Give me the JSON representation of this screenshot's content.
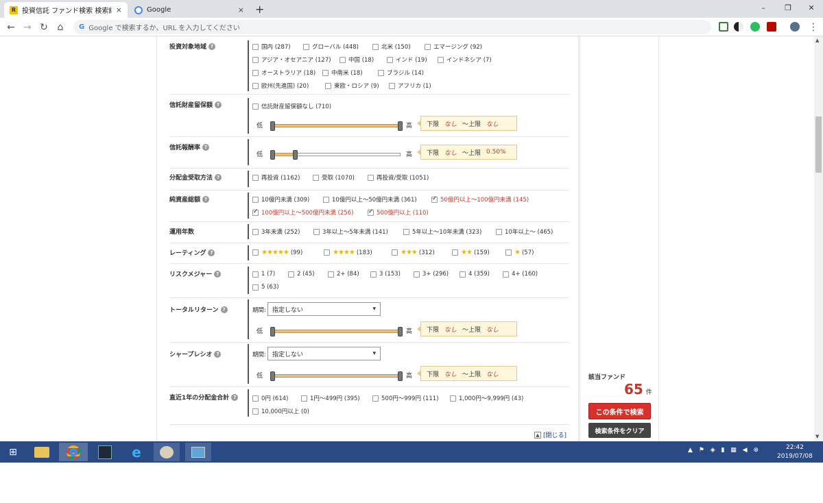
{
  "browser": {
    "tabs": [
      {
        "title": "投資信託 ファンド検索 検索結果",
        "close": "×"
      },
      {
        "title": "Google",
        "close": "×"
      }
    ],
    "new_tab": "+",
    "omnibox_placeholder": "Google で検索するか、URL を入力してください",
    "window_controls": {
      "minimize": "–",
      "maximize": "❐",
      "close": "✕"
    }
  },
  "filters": {
    "region": {
      "label": "投資対象地域",
      "options": [
        {
          "text": "国内 (287)",
          "checked": false
        },
        {
          "text": "グローバル (448)",
          "checked": false
        },
        {
          "text": "北米 (150)",
          "checked": false
        },
        {
          "text": "エマージング (92)",
          "checked": false
        },
        {
          "text": "アジア・オセアニア (127)",
          "checked": false
        },
        {
          "text": "中国 (18)",
          "checked": false
        },
        {
          "text": "インド (19)",
          "checked": false
        },
        {
          "text": "インドネシア (7)",
          "checked": false
        },
        {
          "text": "オーストラリア (18)",
          "checked": false
        },
        {
          "text": "中南米 (18)",
          "checked": false
        },
        {
          "text": "ブラジル (14)",
          "checked": false
        },
        {
          "text": "欧州(先進国) (20)",
          "checked": false
        },
        {
          "text": "東欧・ロシア (9)",
          "checked": false
        },
        {
          "text": "アフリカ (1)",
          "checked": false
        }
      ]
    },
    "reserve": {
      "label": "信託財産留保額",
      "options": [
        {
          "text": "信託財産留保額なし (710)",
          "checked": false
        }
      ],
      "low": "低",
      "high": "高",
      "range": {
        "min_label": "下限",
        "min_value": "なし",
        "max_label": "～上限",
        "max_value": "なし"
      }
    },
    "fee": {
      "label": "信託報酬率",
      "low": "低",
      "high": "高",
      "slider_fraction": 0.18,
      "range": {
        "min_label": "下限",
        "min_value": "なし",
        "max_label": "～上限",
        "max_value": "0.50%"
      }
    },
    "distribution": {
      "label": "分配金受取方法",
      "options": [
        {
          "text": "再投資 (1162)",
          "checked": false
        },
        {
          "text": "受取 (1070)",
          "checked": false
        },
        {
          "text": "再投資/受取 (1051)",
          "checked": false
        }
      ]
    },
    "assets": {
      "label": "純資産総額",
      "options": [
        {
          "text": "10億円未満 (309)",
          "checked": false
        },
        {
          "text": "10億円以上～50億円未満 (361)",
          "checked": false
        },
        {
          "text": "50億円以上～100億円未満 (145)",
          "checked": true
        },
        {
          "text": "100億円以上～500億円未満 (256)",
          "checked": true
        },
        {
          "text": "500億円以上 (110)",
          "checked": true
        }
      ]
    },
    "years": {
      "label": "運用年数",
      "options": [
        {
          "text": "3年未満 (252)",
          "checked": false
        },
        {
          "text": "3年以上～5年未満 (141)",
          "checked": false
        },
        {
          "text": "5年以上～10年未満 (323)",
          "checked": false
        },
        {
          "text": "10年以上～ (465)",
          "checked": false
        }
      ]
    },
    "rating": {
      "label": "レーティング",
      "options": [
        {
          "stars": "★★★★★",
          "count": "(99)"
        },
        {
          "stars": "★★★★",
          "count": "(183)"
        },
        {
          "stars": "★★★",
          "count": "(312)"
        },
        {
          "stars": "★★",
          "count": "(159)"
        },
        {
          "stars": "★",
          "count": "(57)"
        }
      ]
    },
    "risk": {
      "label": "リスクメジャー",
      "options": [
        {
          "text": "1 (7)"
        },
        {
          "text": "2 (45)"
        },
        {
          "text": "2+ (84)"
        },
        {
          "text": "3 (153)"
        },
        {
          "text": "3+ (296)"
        },
        {
          "text": "4 (359)"
        },
        {
          "text": "4+ (160)"
        },
        {
          "text": "5 (63)"
        }
      ]
    },
    "total_return": {
      "label": "トータルリターン",
      "period_label": "期間:",
      "period_value": "指定しない",
      "low": "低",
      "high": "高",
      "range": {
        "min_label": "下限",
        "min_value": "なし",
        "max_label": "～上限",
        "max_value": "なし"
      }
    },
    "sharpe": {
      "label": "シャープレシオ",
      "period_label": "期間:",
      "period_value": "指定しない",
      "low": "低",
      "high": "高",
      "range": {
        "min_label": "下限",
        "min_value": "なし",
        "max_label": "～上限",
        "max_value": "なし"
      }
    },
    "dividend": {
      "label": "直近1年の分配金合計",
      "options": [
        {
          "text": "0円 (614)"
        },
        {
          "text": "1円～499円 (395)"
        },
        {
          "text": "500円～999円 (111)"
        },
        {
          "text": "1,000円～9,999円 (43)"
        },
        {
          "text": "10,000円以上 (0)"
        }
      ]
    },
    "close_link": "[閉じる]",
    "help_mark": "?"
  },
  "result": {
    "label": "該当ファンド",
    "count": "65",
    "unit": "件",
    "search_button": "この条件で検索",
    "clear_button": "検索条件をクリア"
  },
  "taskbar": {
    "time": "22:42",
    "date": "2019/07/08"
  },
  "colors": {
    "accent": "#c0392b",
    "taskbar": "#2a4a86",
    "range_bg": "#fff7dc"
  }
}
